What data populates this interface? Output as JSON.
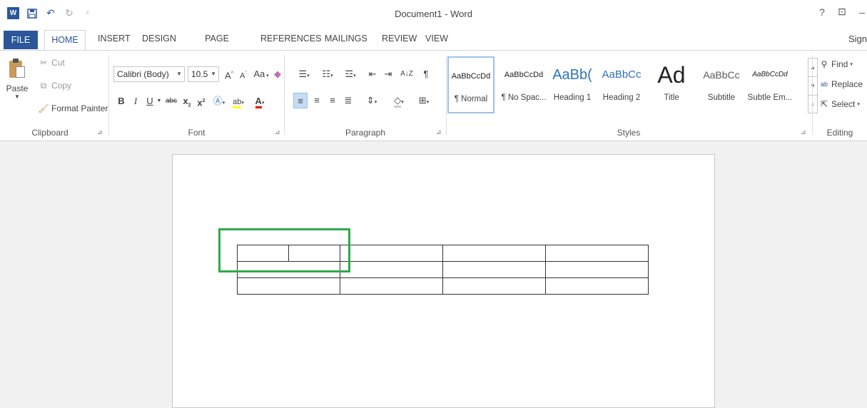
{
  "window": {
    "title": "Document1 - Word",
    "controls": [
      "?",
      "⊡",
      "–"
    ]
  },
  "quick_access": {
    "app_icon": "W",
    "icons": [
      "word-icon",
      "save-icon",
      "undo-icon",
      "redo-icon",
      "customize-icon"
    ]
  },
  "tabs": {
    "file": "FILE",
    "items": [
      "HOME",
      "INSERT",
      "DESIGN",
      "PAGE LAYOUT",
      "REFERENCES",
      "MAILINGS",
      "REVIEW",
      "VIEW"
    ],
    "active": "HOME",
    "signin": "Sign"
  },
  "clipboard": {
    "paste": "Paste",
    "cut": "Cut",
    "copy": "Copy",
    "format_painter": "Format Painter",
    "label": "Clipboard"
  },
  "font": {
    "name": "Calibri (Body)",
    "size": "10.5",
    "grow": "A",
    "shrink": "A",
    "case": "Aa",
    "bold": "B",
    "italic": "I",
    "underline": "U",
    "strike": "abc",
    "subscript": "x",
    "superscript": "x",
    "label": "Font"
  },
  "paragraph": {
    "label": "Paragraph",
    "sort": "A↓Z",
    "pilcrow": "¶"
  },
  "styles": {
    "label": "Styles",
    "items": [
      {
        "sample": "AaBbCcDd",
        "name": "¶ Normal"
      },
      {
        "sample": "AaBbCcDd",
        "name": "¶ No Spac..."
      },
      {
        "sample": "AaBb(",
        "name": "Heading 1"
      },
      {
        "sample": "AaBbCc",
        "name": "Heading 2"
      },
      {
        "sample": "Ad",
        "name": "Title"
      },
      {
        "sample": "AaBbCc",
        "name": "Subtitle"
      },
      {
        "sample": "AaBbCcDd",
        "name": "Subtle Em..."
      }
    ]
  },
  "editing": {
    "find": "Find",
    "replace": "Replace",
    "select": "Select",
    "label": "Editing"
  },
  "colors": {
    "accent": "#2b579a",
    "highlight_box": "#2eaa4a",
    "heading_blue": "#2e74b5",
    "subtitle_gray": "#595959"
  }
}
